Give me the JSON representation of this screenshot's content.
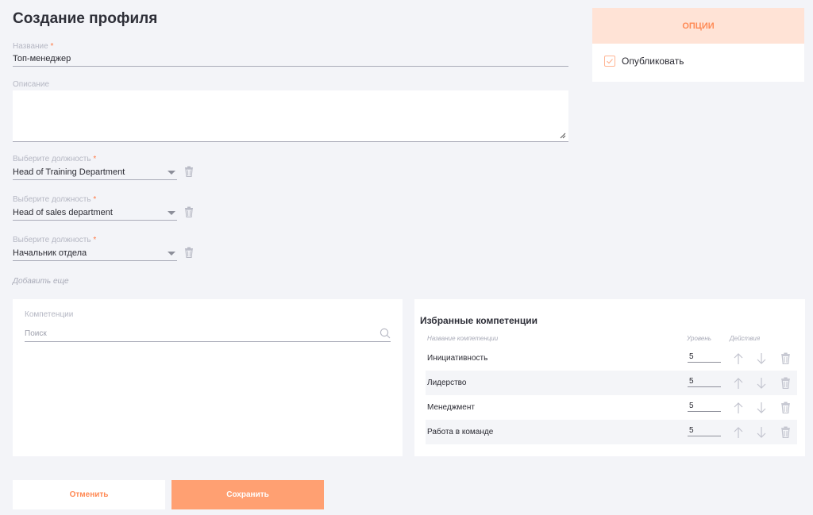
{
  "page": {
    "title": "Создание профиля"
  },
  "form": {
    "name": {
      "label": "Название",
      "required_mark": "*",
      "value": "Топ-менеджер"
    },
    "description": {
      "label": "Описание",
      "value": ""
    },
    "positions": [
      {
        "label": "Выберите должность",
        "required_mark": "*",
        "value": "Head of Training Department"
      },
      {
        "label": "Выберите должность",
        "required_mark": "*",
        "value": "Head of sales department"
      },
      {
        "label": "Выберите должность",
        "required_mark": "*",
        "value": "Начальник отдела"
      }
    ],
    "add_more": "Добавить еще"
  },
  "options": {
    "header": "ОПЦИИ",
    "publish_label": "Опубликовать",
    "publish_checked": true
  },
  "competencies": {
    "label": "Компетенции",
    "search_placeholder": "Поиск"
  },
  "favorites": {
    "title": "Избранные компетенции",
    "columns": {
      "name": "Название компетенции",
      "level": "Уровень",
      "actions": "Действия"
    },
    "rows": [
      {
        "name": "Инициативность",
        "level": "5"
      },
      {
        "name": "Лидерство",
        "level": "5"
      },
      {
        "name": "Менеджмент",
        "level": "5"
      },
      {
        "name": "Работа в команде",
        "level": "5"
      }
    ]
  },
  "buttons": {
    "cancel": "Отменить",
    "save": "Сохранить"
  },
  "colors": {
    "accent": "#ff8a55",
    "accent_light": "#ffe3d6",
    "save_bg": "#ffa072",
    "page_bg": "#f3f4f8"
  }
}
